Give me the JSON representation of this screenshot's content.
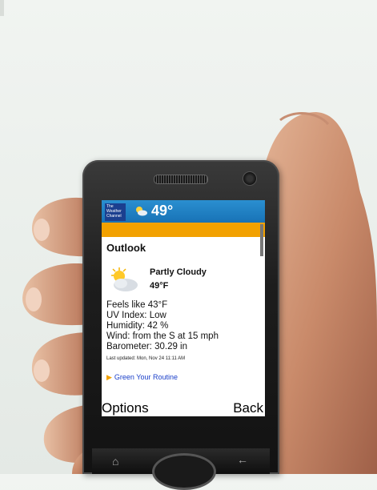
{
  "header": {
    "logo_text": "The Weather Channel",
    "temp": "49°"
  },
  "content": {
    "section_title": "Outlook",
    "condition": "Partly Cloudy",
    "temperature": "49°F",
    "details": [
      "Feels like 43°F",
      "UV Index: Low",
      "Humidity: 42 %",
      "Wind: from the S at 15 mph",
      "Barometer: 30.29 in"
    ],
    "last_updated": "Last updated: Mon, Nov 24 11:11 AM",
    "link": "Green Your Routine"
  },
  "softkeys": {
    "left": "Options",
    "right": "Back"
  },
  "icons": {
    "weather": "partly-cloudy-icon",
    "home": "home-icon",
    "back": "back-arrow-icon"
  },
  "colors": {
    "header_blue": "#1872b6",
    "orange_bar": "#f2a100",
    "link_blue": "#1a3fc9"
  }
}
